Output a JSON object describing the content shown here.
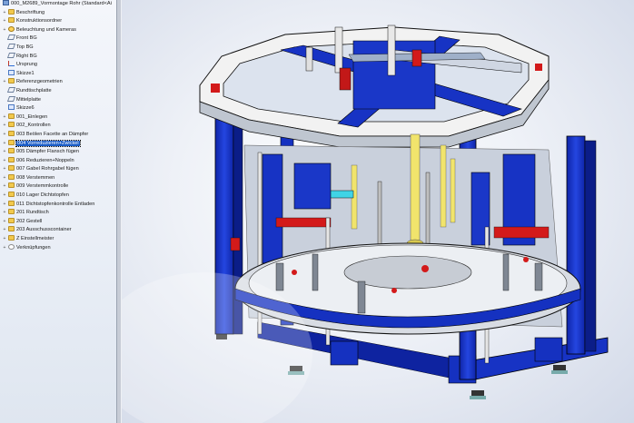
{
  "tree": {
    "root_label": "000_M2689_Vormontage Rohr  (Standard<Ai",
    "items": [
      {
        "label": "Beschriftung",
        "icon": "folder-icon",
        "expander": "+"
      },
      {
        "label": "Konstruktionsordner",
        "icon": "folder-icon",
        "expander": "+"
      },
      {
        "label": "Beleuchtung und Kameras",
        "icon": "light-icon",
        "expander": "+"
      },
      {
        "label": "Front BG",
        "icon": "plane-icon",
        "expander": ""
      },
      {
        "label": "Top BG",
        "icon": "plane-icon",
        "expander": ""
      },
      {
        "label": "Right BG",
        "icon": "plane-icon",
        "expander": ""
      },
      {
        "label": "Ursprung",
        "icon": "origin-icon",
        "expander": ""
      },
      {
        "label": "Skizze1",
        "icon": "sketch-icon",
        "expander": ""
      },
      {
        "label": "Referenzgeometrien",
        "icon": "folder-icon",
        "expander": "+"
      },
      {
        "label": "Rundtischplatte",
        "icon": "plane-icon",
        "expander": ""
      },
      {
        "label": "Mittelplatte",
        "icon": "plane-icon",
        "expander": ""
      },
      {
        "label": "Skizze6",
        "icon": "sketch-icon",
        "expander": ""
      },
      {
        "label": "001_Einlegen",
        "icon": "folder-icon",
        "expander": "+"
      },
      {
        "label": "002_Kontrollen",
        "icon": "folder-icon",
        "expander": "+"
      },
      {
        "label": "003 Beölen Facette an Dämpfer",
        "icon": "folder-icon",
        "expander": "+"
      },
      {
        "label": "004 Vorreduzieren+Zwickel",
        "icon": "folder-icon",
        "expander": "+",
        "selected": true
      },
      {
        "label": "005 Dämpfer Flansch fügen",
        "icon": "folder-icon",
        "expander": "+"
      },
      {
        "label": "006 Reduzieren+Noppeln",
        "icon": "folder-icon",
        "expander": "+"
      },
      {
        "label": "007 Gabel Rohrgabel fügen",
        "icon": "folder-icon",
        "expander": "+"
      },
      {
        "label": "008 Verstemmen",
        "icon": "folder-icon",
        "expander": "+"
      },
      {
        "label": "009 Verstemmkontrolle",
        "icon": "folder-icon",
        "expander": "+"
      },
      {
        "label": "010 Lager Dichtstopfen",
        "icon": "folder-icon",
        "expander": "+"
      },
      {
        "label": "011 Dichtstopfenkontrolle Entladen",
        "icon": "folder-icon",
        "expander": "+"
      },
      {
        "label": "201 Rundtisch",
        "icon": "folder-icon",
        "expander": "+"
      },
      {
        "label": "202 Gestell",
        "icon": "folder-icon",
        "expander": "+"
      },
      {
        "label": "203 Ausschusscontainer",
        "icon": "folder-icon",
        "expander": "+"
      },
      {
        "label": "Z Einstellmeister",
        "icon": "folder-icon",
        "expander": "+"
      },
      {
        "label": "Verknüpfungen",
        "icon": "mate-icon",
        "expander": "+"
      }
    ]
  },
  "viewport": {
    "model": "rotary-table-assembly-machine",
    "colors": {
      "frame": "#1a37c8",
      "white": "#f4f4f4",
      "red": "#d31a1a",
      "yellow": "#f1e46c",
      "cyan": "#3fd4e6",
      "grey": "#9aa0a8"
    }
  }
}
